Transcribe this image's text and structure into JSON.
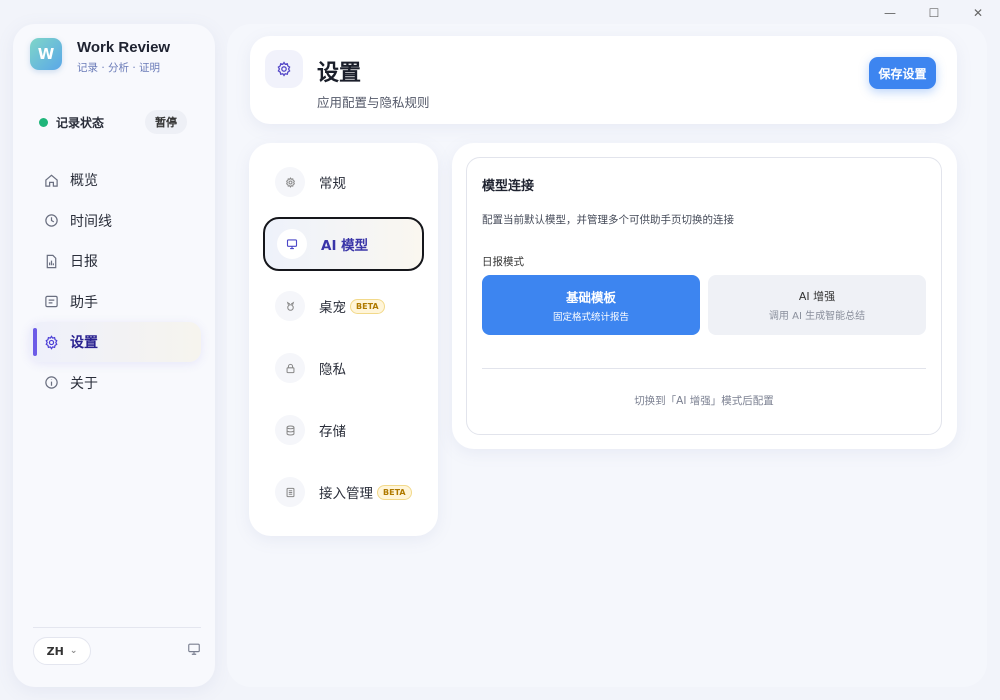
{
  "window": {
    "minimize": "—",
    "maximize": "☐",
    "close": "✕"
  },
  "brand": {
    "logo_text": "W",
    "name": "Work Review",
    "tagline": "记录 · 分析 · 证明"
  },
  "status": {
    "label": "记录状态",
    "pause_label": "暂停",
    "color": "#1fb57a"
  },
  "sidebar": {
    "items": [
      {
        "label": "概览",
        "icon": "home-icon"
      },
      {
        "label": "时间线",
        "icon": "clock-icon"
      },
      {
        "label": "日报",
        "icon": "report-icon"
      },
      {
        "label": "助手",
        "icon": "assistant-icon"
      },
      {
        "label": "设置",
        "icon": "gear-icon",
        "active": true
      },
      {
        "label": "关于",
        "icon": "info-icon"
      }
    ],
    "language": "ZH"
  },
  "header": {
    "title": "设置",
    "subtitle": "应用配置与隐私规则",
    "save_label": "保存设置"
  },
  "settings_nav": {
    "items": [
      {
        "label": "常规",
        "icon": "gear-icon"
      },
      {
        "label": "AI 模型",
        "icon": "monitor-icon",
        "active": true
      },
      {
        "label": "桌宠",
        "icon": "pet-icon",
        "badge": "BETA"
      },
      {
        "label": "隐私",
        "icon": "lock-icon"
      },
      {
        "label": "存储",
        "icon": "database-icon"
      },
      {
        "label": "接入管理",
        "icon": "list-icon",
        "badge": "BETA"
      }
    ]
  },
  "model": {
    "title": "模型连接",
    "description": "配置当前默认模型，并管理多个可供助手页切换的连接",
    "mode_label": "日报模式",
    "modes": [
      {
        "title": "基础模板",
        "subtitle": "固定格式统计报告",
        "active": true
      },
      {
        "title": "AI 增强",
        "subtitle": "调用 AI 生成智能总结",
        "active": false
      }
    ],
    "hint": "切换到「AI 增强」模式后配置"
  },
  "colors": {
    "accent": "#3d85f0",
    "active_nav": "#6c5ce7"
  }
}
